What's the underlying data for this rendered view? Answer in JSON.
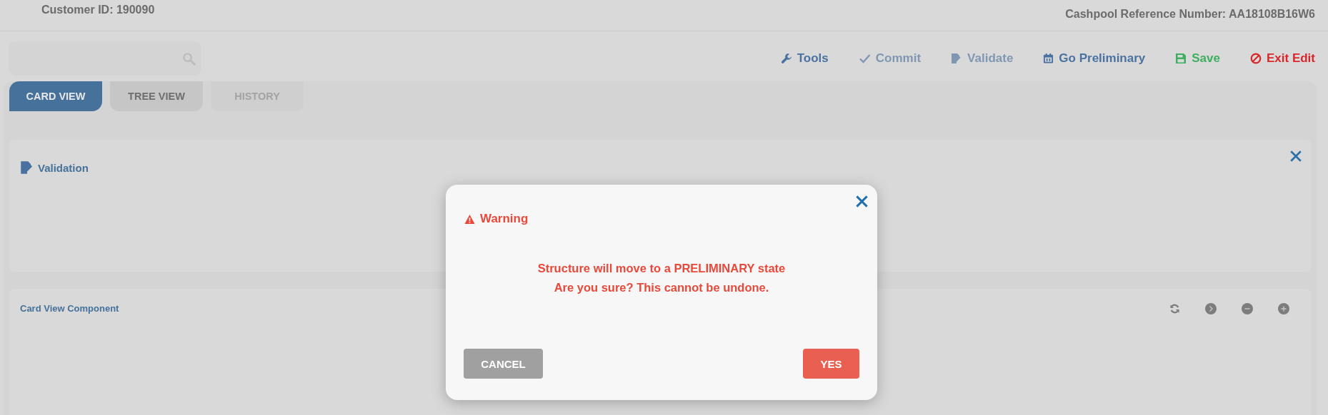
{
  "header": {
    "customer": "Customer ID: 190090",
    "reference": "Cashpool Reference Number: AA18108B16W6"
  },
  "toolbar": [
    {
      "kind": "tools",
      "label": "Tools",
      "disabled": false
    },
    {
      "kind": "commit",
      "label": "Commit",
      "disabled": true
    },
    {
      "kind": "validate",
      "label": "Validate",
      "disabled": true
    },
    {
      "kind": "go-preliminary",
      "label": "Go Preliminary",
      "disabled": false
    },
    {
      "kind": "save",
      "label": "Save",
      "disabled": false
    },
    {
      "kind": "exit",
      "label": "Exit Edit",
      "disabled": false
    }
  ],
  "tabs": [
    {
      "label": "CARD VIEW",
      "selected": true,
      "disabled": false
    },
    {
      "label": "TREE VIEW",
      "selected": false,
      "disabled": false
    },
    {
      "label": "HISTORY",
      "selected": false,
      "disabled": true
    }
  ],
  "validation_panel": {
    "title": "Validation"
  },
  "card_view_panel": {
    "title": "Card View Component"
  },
  "dialog": {
    "title": "Warning",
    "lines": [
      "Structure will move to a PRELIMINARY state",
      "Are you sure? This cannot be undone."
    ],
    "cancel": "CANCEL",
    "confirm": "YES"
  }
}
